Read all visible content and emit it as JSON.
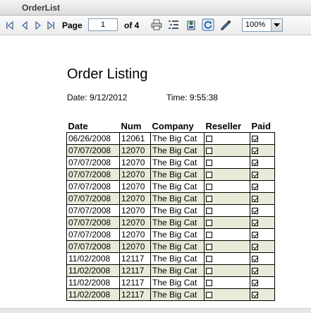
{
  "window": {
    "title": "OrderList"
  },
  "toolbar": {
    "page_label": "Page",
    "page_value": "1",
    "of_label": "of 4",
    "zoom": "100%"
  },
  "report": {
    "title": "Order Listing",
    "date_line": "Date: 9/12/2012",
    "time_line": "Time: 9:55:38",
    "columns": [
      "Date",
      "Num",
      "Company",
      "Reseller",
      "Paid"
    ],
    "rows": [
      {
        "date": "06/26/2008",
        "num": "12061",
        "company": "The Big Cat",
        "reseller": false,
        "paid": true
      },
      {
        "date": "07/07/2008",
        "num": "12070",
        "company": "The Big Cat",
        "reseller": false,
        "paid": true
      },
      {
        "date": "07/07/2008",
        "num": "12070",
        "company": "The Big Cat",
        "reseller": false,
        "paid": true
      },
      {
        "date": "07/07/2008",
        "num": "12070",
        "company": "The Big Cat",
        "reseller": false,
        "paid": true
      },
      {
        "date": "07/07/2008",
        "num": "12070",
        "company": "The Big Cat",
        "reseller": false,
        "paid": true
      },
      {
        "date": "07/07/2008",
        "num": "12070",
        "company": "The Big Cat",
        "reseller": false,
        "paid": true
      },
      {
        "date": "07/07/2008",
        "num": "12070",
        "company": "The Big Cat",
        "reseller": false,
        "paid": true
      },
      {
        "date": "07/07/2008",
        "num": "12070",
        "company": "The Big Cat",
        "reseller": false,
        "paid": true
      },
      {
        "date": "07/07/2008",
        "num": "12070",
        "company": "The Big Cat",
        "reseller": false,
        "paid": true
      },
      {
        "date": "07/07/2008",
        "num": "12070",
        "company": "The Big Cat",
        "reseller": false,
        "paid": true
      },
      {
        "date": "11/02/2008",
        "num": "12117",
        "company": "The Big Cat",
        "reseller": false,
        "paid": true
      },
      {
        "date": "11/02/2008",
        "num": "12117",
        "company": "The Big Cat",
        "reseller": false,
        "paid": true
      },
      {
        "date": "11/02/2008",
        "num": "12117",
        "company": "The Big Cat",
        "reseller": false,
        "paid": true
      },
      {
        "date": "11/02/2008",
        "num": "12117",
        "company": "The Big Cat",
        "reseller": false,
        "paid": true
      }
    ]
  }
}
